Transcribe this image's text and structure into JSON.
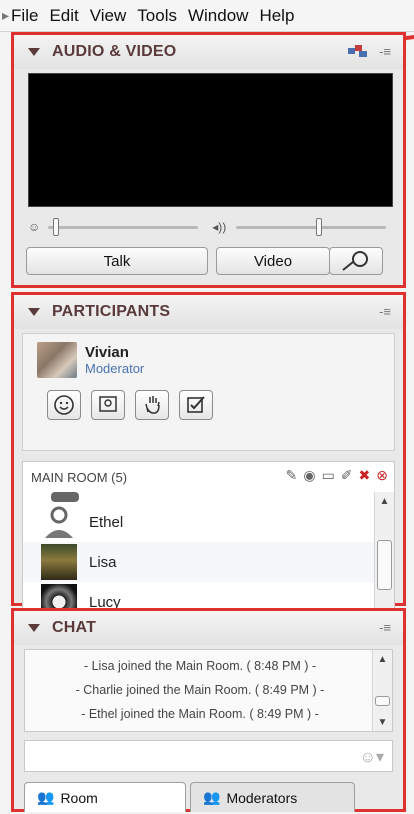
{
  "menubar": {
    "items": [
      "File",
      "Edit",
      "View",
      "Tools",
      "Window",
      "Help"
    ]
  },
  "audio_video": {
    "title": "AUDIO & VIDEO",
    "talk_label": "Talk",
    "video_label": "Video",
    "mic_level": 0.05,
    "speaker_level": 0.55
  },
  "participants": {
    "title": "PARTICIPANTS",
    "me": {
      "name": "Vivian",
      "role": "Moderator"
    },
    "room_label": "MAIN ROOM (5)",
    "list": [
      {
        "name": "Ethel"
      },
      {
        "name": "Lisa"
      },
      {
        "name": "Lucy"
      }
    ]
  },
  "chat": {
    "title": "CHAT",
    "messages": [
      "- Lisa joined the Main Room. ( 8:48 PM ) -",
      "- Charlie joined the Main Room. ( 8:49 PM ) -",
      "- Ethel joined the Main Room. ( 8:49 PM ) -"
    ],
    "tabs": [
      "Room",
      "Moderators"
    ]
  },
  "colors": {
    "highlight": "#e03131",
    "moderator_text": "#4a73b0"
  }
}
